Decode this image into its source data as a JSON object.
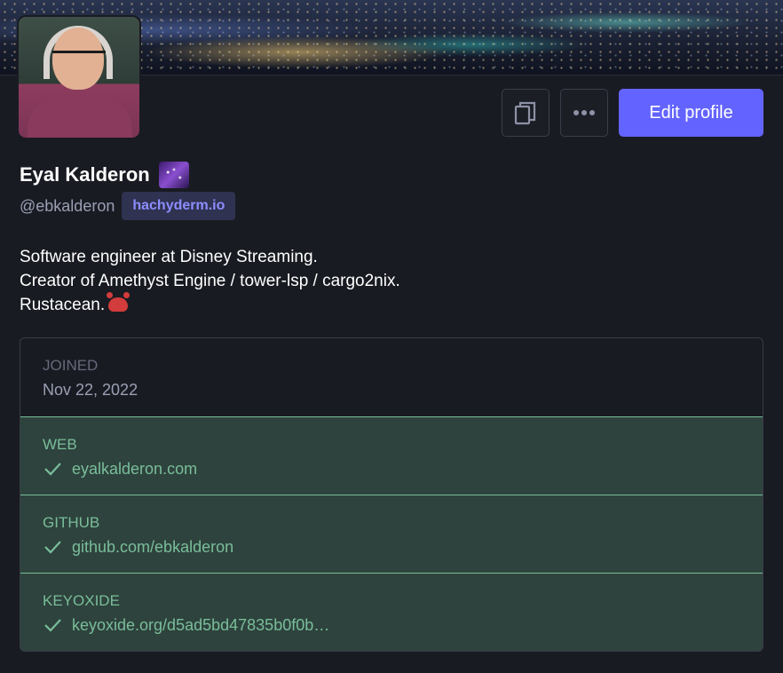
{
  "profile": {
    "display_name": "Eyal Kalderon",
    "handle": "@ebkalderon",
    "domain": "hachyderm.io",
    "bio": [
      "Software engineer at Disney Streaming.",
      "Creator of Amethyst Engine / tower-lsp / cargo2nix.",
      "Rustacean."
    ],
    "name_emoji": "galaxy-emoji",
    "bio_emoji": "crab-emoji"
  },
  "actions": {
    "copy_icon": "copy-icon",
    "more_icon": "ellipsis-icon",
    "edit_label": "Edit profile"
  },
  "fields": [
    {
      "label": "JOINED",
      "value": "Nov 22, 2022",
      "verified": false
    },
    {
      "label": "WEB",
      "value": "eyalkalderon.com",
      "verified": true
    },
    {
      "label": "GITHUB",
      "value": "github.com/ebkalderon",
      "verified": true
    },
    {
      "label": "KEYOXIDE",
      "value": "keyoxide.org/d5ad5bd47835b0f0b…",
      "verified": true
    }
  ],
  "colors": {
    "background": "#191b22",
    "accent": "#6364ff",
    "verified": "#79bd9a",
    "verified_bg": "#2e433d",
    "muted": "#9aa0b4"
  }
}
